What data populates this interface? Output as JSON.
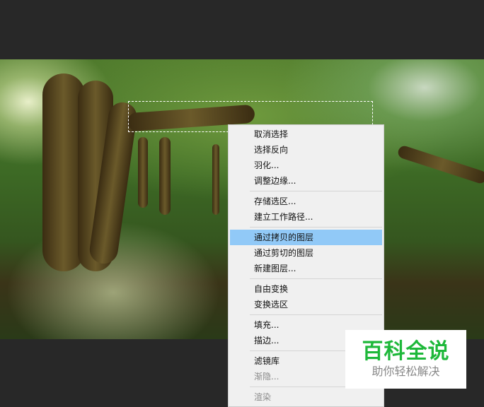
{
  "menu": {
    "items": [
      {
        "label": "取消选择"
      },
      {
        "label": "选择反向"
      },
      {
        "label": "羽化..."
      },
      {
        "label": "调整边缘..."
      },
      {
        "label": "存储选区..."
      },
      {
        "label": "建立工作路径..."
      },
      {
        "label": "通过拷贝的图层"
      },
      {
        "label": "通过剪切的图层"
      },
      {
        "label": "新建图层..."
      },
      {
        "label": "自由变换"
      },
      {
        "label": "变换选区"
      },
      {
        "label": "填充..."
      },
      {
        "label": "描边..."
      },
      {
        "label": "滤镜库"
      },
      {
        "label": "渐隐..."
      },
      {
        "label": "渲染"
      }
    ]
  },
  "watermark": {
    "title": "百科全说",
    "subtitle": "助你轻松解决"
  },
  "colors": {
    "highlight": "#91c9f7",
    "brand": "#1eb83a"
  }
}
